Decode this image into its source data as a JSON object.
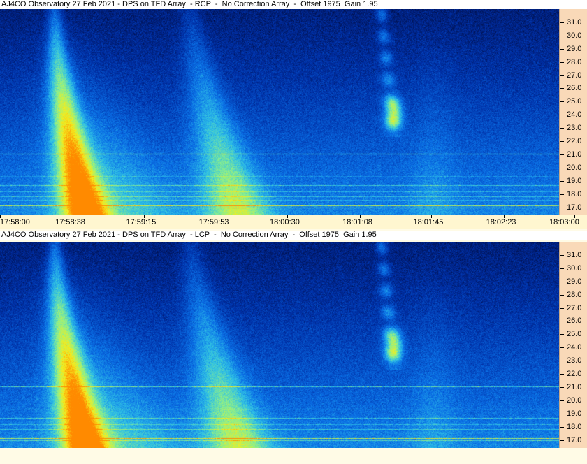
{
  "chart_data": [
    {
      "type": "heatmap",
      "title": "AJ4CO Observatory 27 Feb 2021 - DPS on TFD Array  - RCP  -  No Correction Array  -  Offset 1975  Gain 1.95",
      "polarization": "RCP",
      "y_ticks": [
        "31.0",
        "30.0",
        "29.0",
        "28.0",
        "27.0",
        "26.0",
        "25.0",
        "24.0",
        "23.0",
        "22.0",
        "21.0",
        "20.0",
        "19.0",
        "18.0",
        "17.0"
      ],
      "x_ticks": [
        "17:58:00",
        "17:58:38",
        "17:59:15",
        "17:59:53",
        "18:00:30",
        "18:01:08",
        "18:01:45",
        "18:02:23",
        "18:03:00"
      ],
      "ylim": [
        16.4,
        32.0
      ],
      "xlim": [
        "17:58:00",
        "18:03:00"
      ],
      "colormap": [
        "#000a3c",
        "#002fa6",
        "#0a6fe6",
        "#2ec0e6",
        "#8ef08a",
        "#f4ee1e",
        "#ff8a00"
      ]
    },
    {
      "type": "heatmap",
      "title": "AJ4CO Observatory 27 Feb 2021 - DPS on TFD Array  - LCP  -  No Correction Array  -  Offset 1975  Gain 1.95",
      "polarization": "LCP",
      "y_ticks": [
        "31.0",
        "30.0",
        "29.0",
        "28.0",
        "27.0",
        "26.0",
        "25.0",
        "24.0",
        "23.0",
        "22.0",
        "21.0",
        "20.0",
        "19.0",
        "18.0",
        "17.0"
      ],
      "ylim": [
        16.4,
        32.0
      ],
      "xlim": [
        "17:58:00",
        "18:03:00"
      ],
      "colormap": [
        "#000a3c",
        "#002fa6",
        "#0a6fe6",
        "#2ec0e6",
        "#8ef08a",
        "#f4ee1e",
        "#ff8a00"
      ]
    }
  ]
}
